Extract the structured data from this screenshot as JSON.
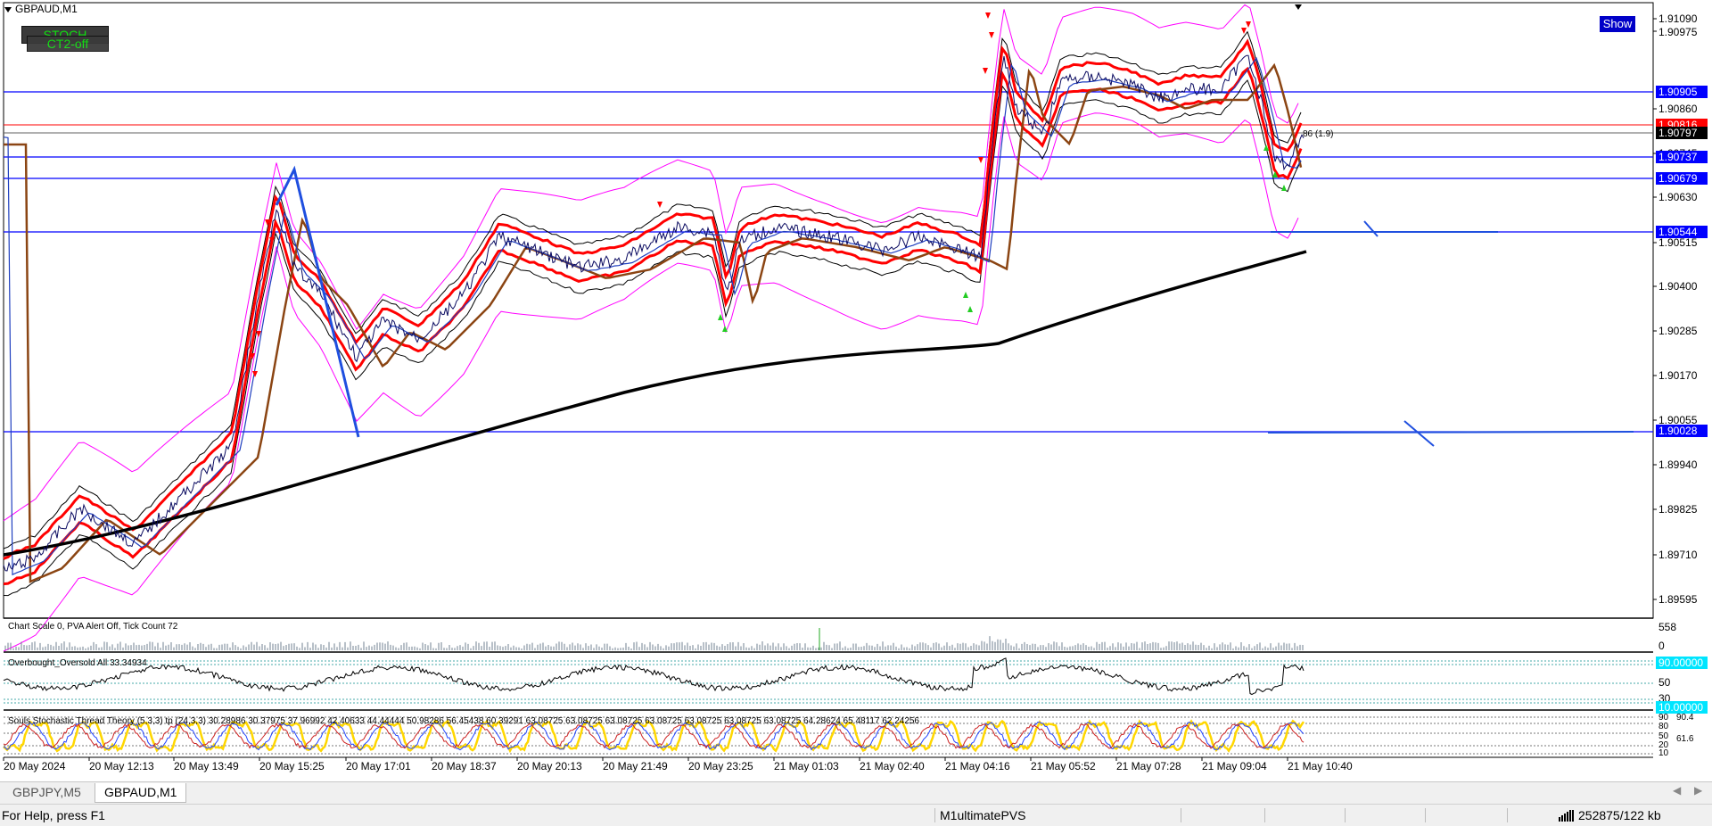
{
  "window": {
    "symbol_title": "GBPAUD,M1",
    "stoch_button": "STOCH",
    "ct2_button": "CT2-off",
    "show_button": "Show"
  },
  "indicators": {
    "volume_panel_label": "Chart Scale 0,  PVA Alert Off,  Tick Count 72",
    "volume_scale_top": "558",
    "volume_scale_bottom": "0",
    "oscillator_label": "Overbought_Oversold  All 33.34934",
    "oscillator_tag_top": "90.00000",
    "oscillator_tag_bottom": "10.00000",
    "oscillator_levels": [
      "50",
      "30"
    ],
    "stoch_label": "Souls Stochastic Thread Theory (5,3,3) tp (24,3,3) 30.28986 30.37975 37.96992 42.40633 44.44444 50.98286 56.45438 60.39291 63.08725 63.08725 63.08725 63.08725 63.08725 63.08725 63.08725 64.28624 65.48117 62.24256",
    "stoch_levels": [
      "90",
      "80",
      "50",
      "20",
      "10"
    ],
    "stoch_levels_extra": [
      "90.4",
      "61.6"
    ],
    "trade_annotation": "86 (1.9)"
  },
  "price_axis": {
    "labels": [
      "1.91090",
      "1.90975",
      "1.90860",
      "1.90745",
      "1.90630",
      "1.90515",
      "1.90400",
      "1.90285",
      "1.90170",
      "1.90055",
      "1.89940",
      "1.89825",
      "1.89710",
      "1.89595"
    ]
  },
  "price_lines": {
    "blue_levels": [
      "1.90905",
      "1.90737",
      "1.90679",
      "1.90544",
      "1.90028"
    ],
    "red_level": "1.90816",
    "current_price": "1.90797"
  },
  "time_axis": {
    "labels": [
      "20 May 2024",
      "20 May 12:13",
      "20 May 13:49",
      "20 May 15:25",
      "20 May 17:01",
      "20 May 18:37",
      "20 May 20:13",
      "20 May 21:49",
      "20 May 23:25",
      "21 May 01:03",
      "21 May 02:40",
      "21 May 04:16",
      "21 May 05:52",
      "21 May 07:28",
      "21 May 09:04",
      "21 May 10:40"
    ]
  },
  "tabs": [
    {
      "label": "GBPJPY,M5",
      "active": false
    },
    {
      "label": "GBPAUD,M1",
      "active": true
    }
  ],
  "status": {
    "help_text": "For Help, press F1",
    "profile": "M1ultimatePVS",
    "connection": "252875/122 kb"
  },
  "colors": {
    "price_line_blue": "#0000ff",
    "red_band": "#ff0000",
    "magenta_band": "#ff00ff",
    "long_ma": "#000000",
    "brown_ma": "#8b4513",
    "stoch_yellow": "#ffd700",
    "volume_bars": "#708090"
  }
}
